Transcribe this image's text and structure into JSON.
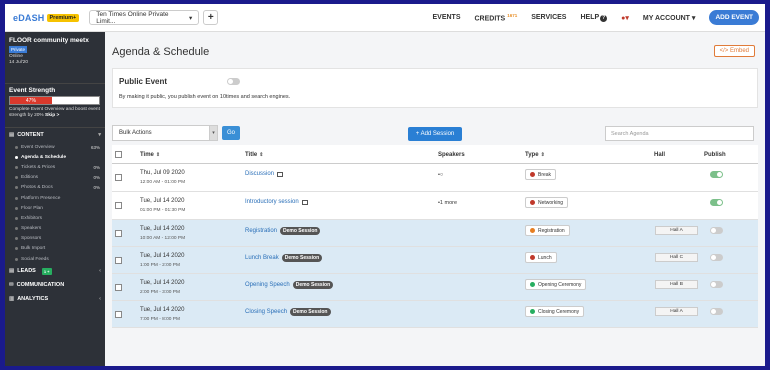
{
  "topbar": {
    "logo": "eDASH",
    "premium_badge": "Premium+",
    "company": "Ten Times Online Private Limit...",
    "company_caret": "▾",
    "plus": "+",
    "nav": {
      "events": "EVENTS",
      "credits": "CREDITS",
      "credits_count": "1671",
      "services": "SERVICES",
      "help": "HELP",
      "my_account": "MY ACCOUNT",
      "add_event": "ADD EVENT"
    }
  },
  "sidebar": {
    "event_name": "FLOOR community meetx",
    "visibility": "Private",
    "mode": "Online",
    "date": "14 Jul'20",
    "strength_title": "Event Strength",
    "strength_percent_label": "47%",
    "strength_value": 0.47,
    "strength_text": "Complete Event Overview and boost event strength by 20%",
    "skip": "Skip >",
    "content_label": "CONTENT",
    "items": [
      {
        "label": "Event Overview",
        "pct": "63%"
      },
      {
        "label": "Agenda & Schedule",
        "pct": ""
      },
      {
        "label": "Tickets & Prices",
        "pct": "0%"
      },
      {
        "label": "Editions",
        "pct": "0%"
      },
      {
        "label": "Photos & Docs",
        "pct": "0%"
      },
      {
        "label": "Platform Presence",
        "pct": ""
      },
      {
        "label": "Floor Plan",
        "pct": ""
      },
      {
        "label": "Exhibitors",
        "pct": ""
      },
      {
        "label": "Speakers",
        "pct": ""
      },
      {
        "label": "Sponsors",
        "pct": ""
      },
      {
        "label": "Bulk Import",
        "pct": ""
      },
      {
        "label": "Social Feeds",
        "pct": ""
      }
    ],
    "leads_label": "LEADS",
    "leads_badge": "1 +",
    "communication_label": "COMMUNICATION",
    "analytics_label": "ANALYTICS"
  },
  "main": {
    "page_title": "Agenda & Schedule",
    "embed_label": "</> Embed",
    "public_title": "Public Event",
    "public_desc": "By making it public, you publish event on 10times and search engines.",
    "bulk_actions": "Bulk Actions",
    "go": "Go",
    "add_session": "+ Add Session",
    "search_placeholder": "Search Agenda",
    "columns": {
      "time": "Time",
      "title": "Title",
      "speakers": "Speakers",
      "type": "Type",
      "hall": "Hall",
      "publish": "Publish"
    },
    "demo_label": "Demo Session",
    "rows": [
      {
        "date": "Thu, Jul 09 2020",
        "time": "12:00 AM - 01:00 PM",
        "title": "Discussion",
        "speakers": "•○",
        "type": "Break",
        "type_color": "#c0392b",
        "hall": "",
        "publish": true
      },
      {
        "date": "Tue, Jul 14 2020",
        "time": "01:00 PM - 01:30 PM",
        "title": "Introductory session",
        "speakers": "•1 more",
        "type": "Networking",
        "type_color": "#c0392b",
        "hall": "",
        "publish": true
      },
      {
        "date": "Tue, Jul 14 2020",
        "time": "10:00 AM - 12:00 PM",
        "title": "Registration",
        "speakers": "",
        "type": "Registration",
        "type_color": "#e67e22",
        "hall": "Hall A",
        "publish": false
      },
      {
        "date": "Tue, Jul 14 2020",
        "time": "1:00 PM - 2:00 PM",
        "title": "Lunch Break",
        "speakers": "",
        "type": "Lunch",
        "type_color": "#c0392b",
        "hall": "Hall C",
        "publish": false
      },
      {
        "date": "Tue, Jul 14 2020",
        "time": "2:00 PM - 3:00 PM",
        "title": "Opening Speech",
        "speakers": "",
        "type": "Opening Ceremony",
        "type_color": "#27ae60",
        "hall": "Hall B",
        "publish": false
      },
      {
        "date": "Tue, Jul 14 2020",
        "time": "7:00 PM - 8:00 PM",
        "title": "Closing Speech",
        "speakers": "",
        "type": "Closing Ceremony",
        "type_color": "#27ae60",
        "hall": "Hall A",
        "publish": false
      }
    ]
  }
}
